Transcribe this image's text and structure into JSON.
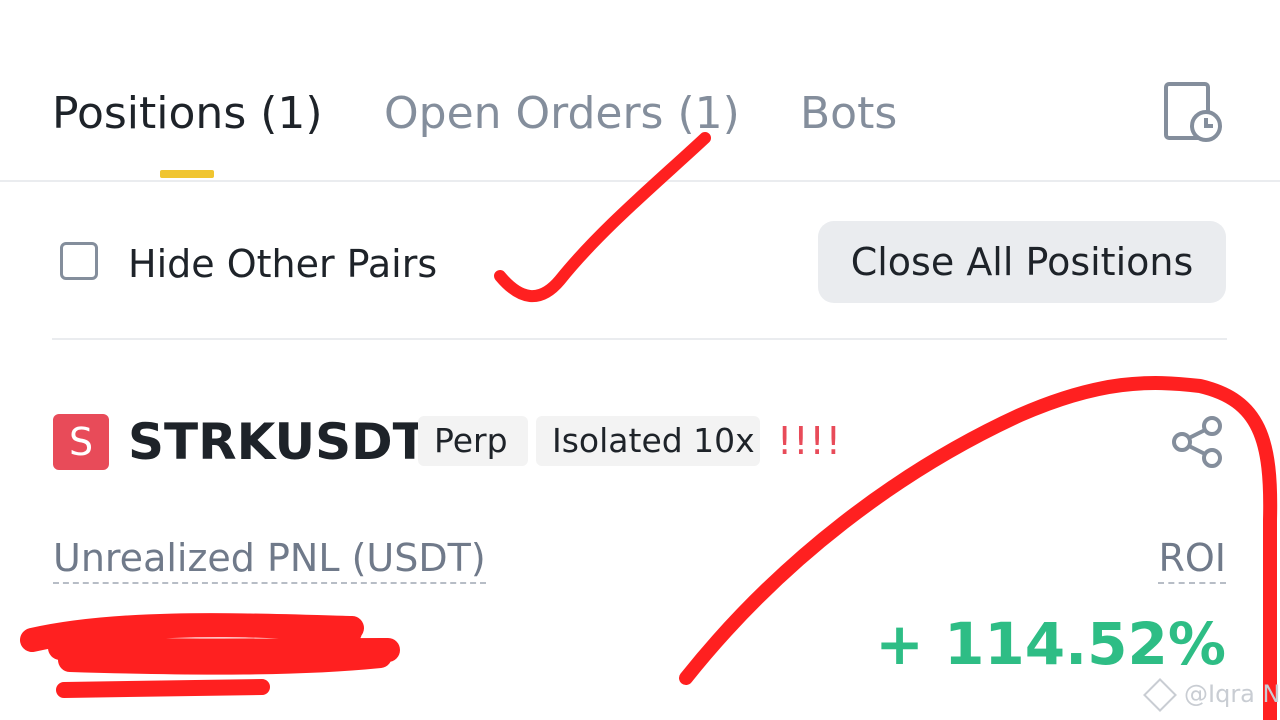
{
  "tabs": {
    "positions": "Positions (1)",
    "open_orders": "Open Orders (1)",
    "bots": "Bots"
  },
  "filters": {
    "hide_other_pairs": "Hide Other Pairs",
    "close_all": "Close All Positions"
  },
  "position": {
    "icon_letter": "S",
    "symbol": "STRKUSDT",
    "type": "Perp",
    "margin": "Isolated 10x",
    "risk": "!!!!",
    "pnl_label": "Unrealized PNL (USDT)",
    "roi_label": "ROI",
    "roi_value": "+ 114.52%"
  },
  "watermark": "@Iqra N",
  "colors": {
    "accent": "#f0c530",
    "positive": "#2ebd85",
    "negative": "#e84b59",
    "annotation": "#ff2020"
  },
  "icons": {
    "history": "history-clock-icon",
    "share": "share-icon",
    "coin": "coin-icon"
  }
}
